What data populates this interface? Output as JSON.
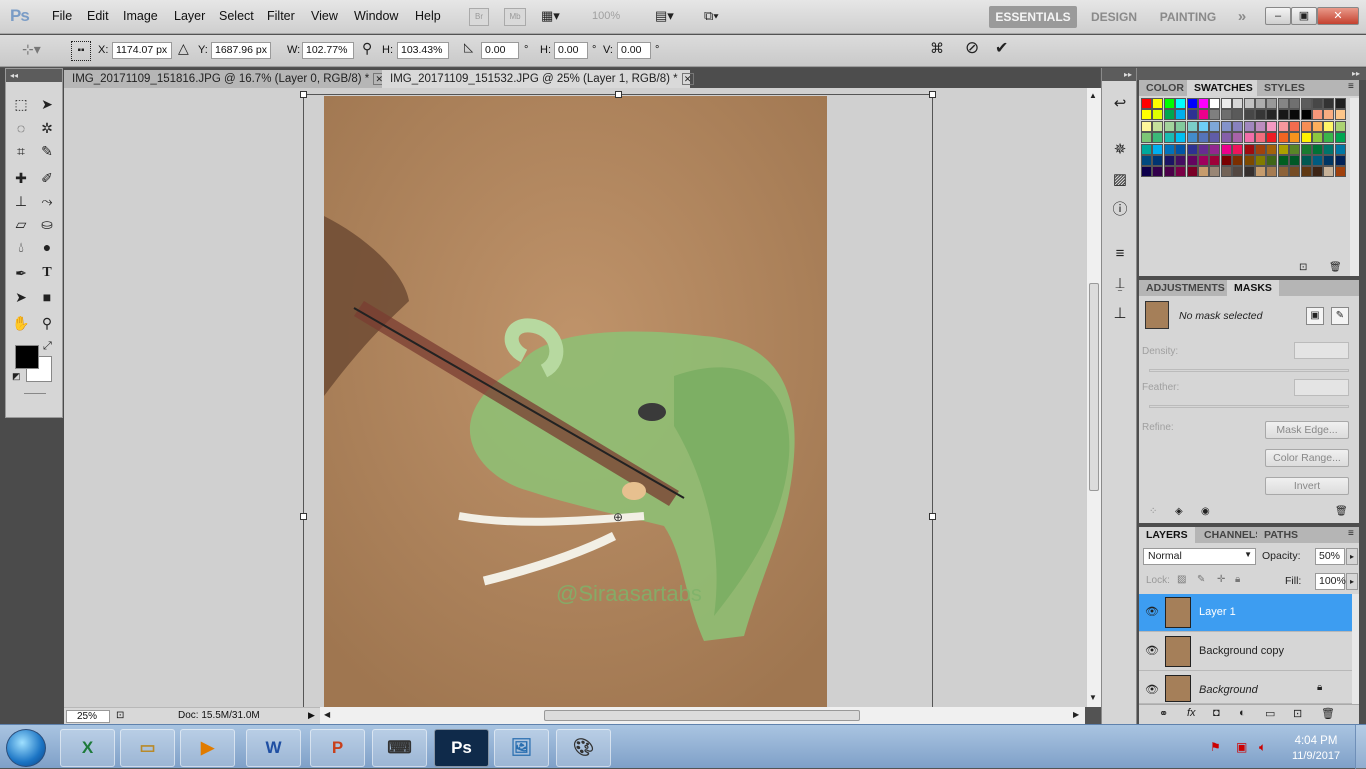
{
  "app": {
    "logo": "Ps"
  },
  "menu": [
    "File",
    "Edit",
    "Image",
    "Layer",
    "Select",
    "Filter",
    "View",
    "Window",
    "Help"
  ],
  "menubar_icons": {
    "bridge": "Br",
    "mini_bridge": "Mb",
    "zoom": "100%"
  },
  "workspaces": [
    "ESSENTIALS",
    "DESIGN",
    "PAINTING"
  ],
  "workspace_more": "»",
  "window_controls": {
    "minimize": "–",
    "restore": "▣",
    "close": "✕"
  },
  "options": {
    "x_label": "X:",
    "x_value": "1174.07 px",
    "y_label": "Y:",
    "y_value": "1687.96 px",
    "w_label": "W:",
    "w_value": "102.77%",
    "h_label": "H:",
    "h_value": "103.43%",
    "angle_value": "0.00",
    "angle_unit": "°",
    "hskew_label": "H:",
    "hskew_value": "0.00",
    "hskew_unit": "°",
    "vskew_label": "V:",
    "vskew_value": "0.00",
    "vskew_unit": "°",
    "cancel": "⊘",
    "commit": "✔",
    "warp": "⌘"
  },
  "tabs": [
    {
      "label": "IMG_20171109_151816.JPG @ 16.7% (Layer 0, RGB/8) *",
      "close": "✕",
      "active": false
    },
    {
      "label": "IMG_20171109_151532.JPG @ 25% (Layer 1, RGB/8) *",
      "close": "✕",
      "active": true
    }
  ],
  "canvas": {
    "watermark": "@Siraasartabs"
  },
  "status": {
    "zoom": "25%",
    "doc": "Doc: 15.5M/31.0M"
  },
  "panels": {
    "color_tabs": [
      "COLOR",
      "SWATCHES",
      "STYLES"
    ],
    "adjust_tabs": [
      "ADJUSTMENTS",
      "MASKS"
    ],
    "no_mask": "No mask selected",
    "density_label": "Density:",
    "feather_label": "Feather:",
    "refine_label": "Refine:",
    "mask_edge": "Mask Edge...",
    "color_range": "Color Range...",
    "invert": "Invert",
    "layers_tabs": [
      "LAYERS",
      "CHANNELS",
      "PATHS"
    ],
    "blend_mode": "Normal",
    "opacity_label": "Opacity:",
    "opacity_value": "50%",
    "lock_label": "Lock:",
    "fill_label": "Fill:",
    "fill_value": "100%",
    "layers": [
      {
        "name": "Layer 1",
        "selected": true
      },
      {
        "name": "Background copy",
        "selected": false
      },
      {
        "name": "Background",
        "selected": false,
        "locked": true
      }
    ]
  },
  "swatch_colors": [
    "#ff0000",
    "#ffff00",
    "#00ff00",
    "#00ffff",
    "#0000ff",
    "#ff00ff",
    "#ffffff",
    "#ebebeb",
    "#d6d6d6",
    "#c2c2c2",
    "#adadad",
    "#999999",
    "#858585",
    "#707070",
    "#5c5c5c",
    "#474747",
    "#333333",
    "#1f1f1f",
    "#ffff00",
    "#e0ff00",
    "#00a651",
    "#00aeef",
    "#2e3192",
    "#ec008c",
    "#7f7f7f",
    "#6e6e6e",
    "#5a5a5a",
    "#474747",
    "#363636",
    "#252525",
    "#171717",
    "#0a0a0a",
    "#000000",
    "#f7977a",
    "#f9ad81",
    "#fdc68a",
    "#fff79a",
    "#c4df9b",
    "#a2d39c",
    "#82ca9d",
    "#7bcdc8",
    "#6ecff6",
    "#7ea7d8",
    "#8493ca",
    "#8882be",
    "#a187be",
    "#bc8dbf",
    "#f49ac2",
    "#f6989d",
    "#f26c4f",
    "#f68e55",
    "#fbaf5c",
    "#fff467",
    "#acd372",
    "#7cc576",
    "#3bb878",
    "#1abbb4",
    "#00bff3",
    "#438cca",
    "#5574b9",
    "#605ca8",
    "#855fa8",
    "#a763a8",
    "#f06ea9",
    "#f26d7d",
    "#ed1c24",
    "#f26522",
    "#f7941d",
    "#fff200",
    "#8dc73f",
    "#39b54a",
    "#00a651",
    "#00a99d",
    "#00aeef",
    "#0072bc",
    "#0054a6",
    "#2e3192",
    "#662d91",
    "#92278f",
    "#ec008c",
    "#ed145b",
    "#9e0b0f",
    "#a0410d",
    "#a3620a",
    "#aba000",
    "#598527",
    "#197b30",
    "#007236",
    "#00746b",
    "#0076a3",
    "#004a80",
    "#003471",
    "#1b1464",
    "#440e62",
    "#630460",
    "#9e005d",
    "#9e0039",
    "#790000",
    "#7b2e00",
    "#7d4900",
    "#827b00",
    "#406618",
    "#005e20",
    "#005826",
    "#005952",
    "#005b7f",
    "#003663",
    "#002157",
    "#0d004c",
    "#32004b",
    "#4b0049",
    "#7b0046",
    "#7a0026",
    "#c69c6d",
    "#998675",
    "#736357",
    "#534741",
    "#362f2d",
    "#c69c6d",
    "#a67c52",
    "#8c6239",
    "#754c24",
    "#603913",
    "#3c2415",
    "#c7b299",
    "#a0410d"
  ],
  "taskbar": {
    "apps": [
      "X",
      "",
      "▶",
      "W",
      "P",
      "",
      "Ps",
      "",
      ""
    ],
    "time": "4:04 PM",
    "date": "11/9/2017"
  },
  "colors": {
    "selection": "#3d9df1",
    "accent": "#1b74c4"
  }
}
